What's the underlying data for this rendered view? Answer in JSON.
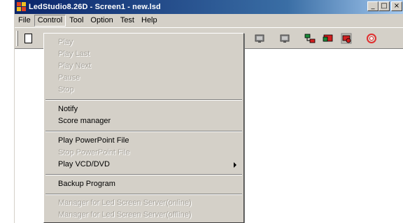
{
  "window": {
    "title": "LedStudio8.26D - Screen1 - new.lsd",
    "buttons": {
      "minimize": "_",
      "maximize": "□",
      "close": "×"
    }
  },
  "menubar": {
    "items": [
      {
        "label": "File"
      },
      {
        "label": "Control"
      },
      {
        "label": "Tool"
      },
      {
        "label": "Option"
      },
      {
        "label": "Test"
      },
      {
        "label": "Help"
      }
    ]
  },
  "toolbar": {
    "icons": [
      "new-file-icon",
      "screen-gray-icon",
      "screen-gray-icon",
      "network-icon",
      "screen-red-icon",
      "screen-power-icon",
      "lifebuoy-icon"
    ],
    "colors": {
      "green": "#1a8a3a",
      "red": "#d02020",
      "gray": "#8a8a8a"
    }
  },
  "control_menu": {
    "items": [
      {
        "label": "Play",
        "enabled": false
      },
      {
        "label": "Play Last",
        "enabled": false
      },
      {
        "label": "Play Next",
        "enabled": false
      },
      {
        "label": "Pause",
        "enabled": false
      },
      {
        "label": "Stop",
        "enabled": false
      },
      {
        "label": "Notify",
        "enabled": true
      },
      {
        "label": "Score manager",
        "enabled": true
      },
      {
        "label": "Play PowerPoint File",
        "enabled": true
      },
      {
        "label": "Stop PowerPoint File",
        "enabled": false
      },
      {
        "label": "Play VCD/DVD",
        "enabled": true,
        "submenu": true
      },
      {
        "label": "Backup Program",
        "enabled": true
      },
      {
        "label": "Manager for Led Screen Server(online)",
        "enabled": false
      },
      {
        "label": "Manager for Led Screen Server(offline)",
        "enabled": false
      }
    ]
  }
}
